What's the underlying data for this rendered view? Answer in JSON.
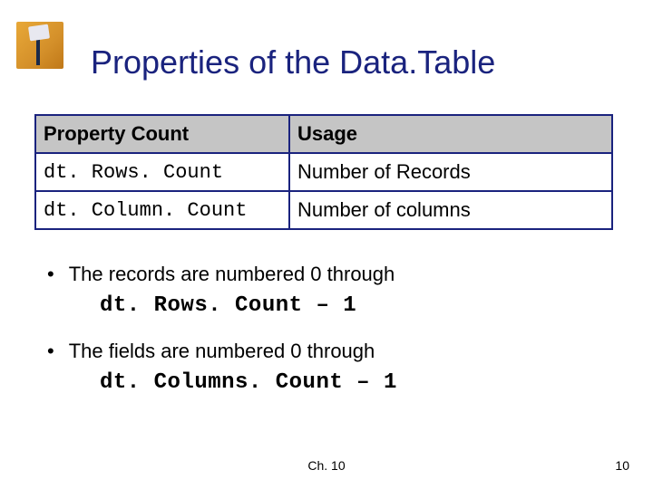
{
  "title": "Properties of the Data.Table",
  "table": {
    "headers": {
      "property": "Property Count",
      "usage": "Usage"
    },
    "rows": [
      {
        "property": "dt. Rows. Count",
        "usage": "Number of Records"
      },
      {
        "property": "dt. Column. Count",
        "usage": "Number of columns"
      }
    ]
  },
  "bullets": [
    {
      "text": "The records are numbered 0 through",
      "code": "dt. Rows. Count – 1"
    },
    {
      "text": "The fields are numbered 0 through",
      "code": "dt. Columns. Count – 1"
    }
  ],
  "footer": {
    "chapter": "Ch. 10",
    "page": "10"
  }
}
